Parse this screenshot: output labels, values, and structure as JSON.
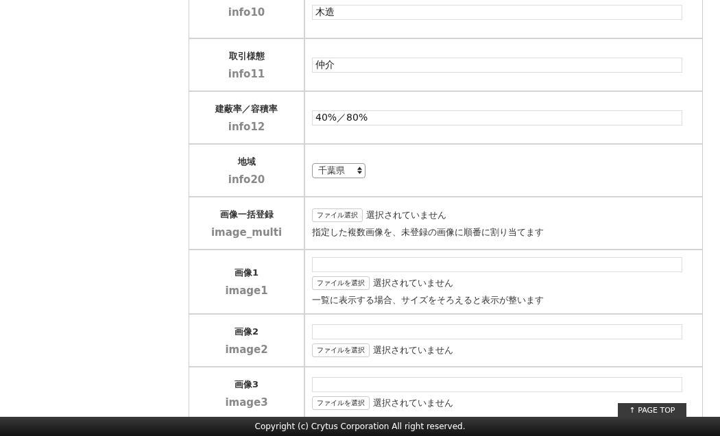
{
  "rows": [
    {
      "key": "info10",
      "kind": "text",
      "value": "木造"
    },
    {
      "label": "取引様態",
      "key": "info11",
      "kind": "text",
      "value": "仲介"
    },
    {
      "label": "建蔽率／容積率",
      "key": "info12",
      "kind": "text",
      "value": "40%／80%"
    },
    {
      "label": "地域",
      "key": "info20",
      "kind": "select",
      "value": "千葉県"
    },
    {
      "label": "画像一括登録",
      "key": "image_multi",
      "kind": "multi",
      "file_button": "ファイル選択",
      "file_status": "選択されていません",
      "note": "指定した複数画像を、未登録の画像に順番に割り当てます"
    },
    {
      "label": "画像1",
      "key": "image1",
      "kind": "image",
      "file_button": "ファイルを選択",
      "file_status": "選択されていません",
      "note": "一覧に表示する場合、サイズをそろえると表示が整います"
    },
    {
      "label": "画像2",
      "key": "image2",
      "kind": "image",
      "file_button": "ファイルを選択",
      "file_status": "選択されていません"
    },
    {
      "label": "画像3",
      "key": "image3",
      "kind": "image",
      "file_button": "ファイルを選択",
      "file_status": "選択されていません"
    }
  ],
  "page_top": {
    "arrow": "↑",
    "label": "PAGE TOP"
  },
  "footer": "Copyright (c) Crytus Corporation All right reserved."
}
